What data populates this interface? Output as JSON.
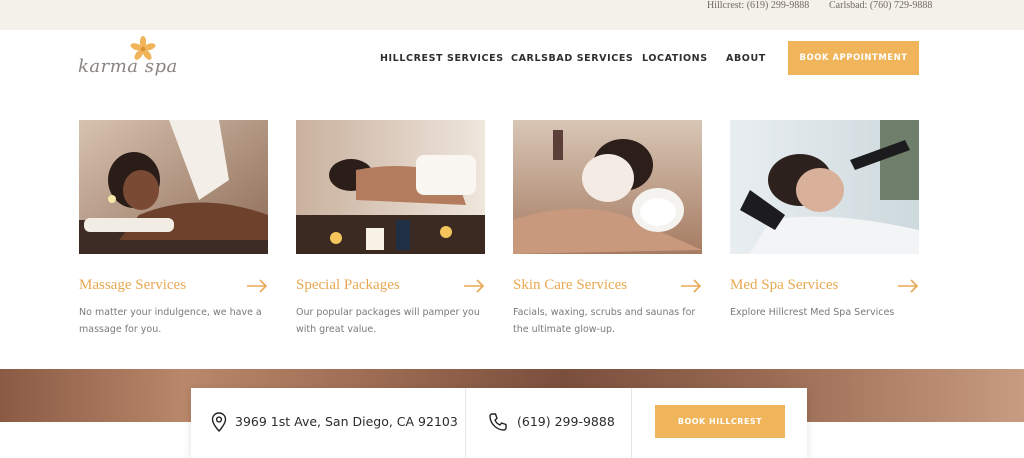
{
  "topbar": {
    "hillcrest_phone": "Hillcrest: (619) 299-9888",
    "carlsbad_phone": "Carlsbad: (760) 729-9888"
  },
  "logo": {
    "text": "karma spa",
    "icon": "flower-logo-icon"
  },
  "nav": {
    "items": [
      "HILLCREST SERVICES",
      "CARLSBAD SERVICES",
      "LOCATIONS",
      "ABOUT"
    ],
    "book_label": "BOOK APPOINTMENT"
  },
  "cards": [
    {
      "title": "Massage Services",
      "desc": "No matter your indulgence, we have a massage for you.",
      "image": "woman-receiving-back-massage"
    },
    {
      "title": "Special Packages",
      "desc": "Our popular packages will pamper you with great value.",
      "image": "woman-spa-facial-with-candles"
    },
    {
      "title": "Skin Care Services",
      "desc": "Facials, waxing, scrubs and saunas for the ultimate glow-up.",
      "image": "woman-with-facial-mask"
    },
    {
      "title": "Med Spa Services",
      "desc": "Explore Hillcrest Med Spa Services",
      "image": "woman-receiving-med-spa-treatment"
    }
  ],
  "infobar": {
    "address": "3969 1st Ave, San Diego, CA 92103",
    "phone": "(619) 299-9888",
    "book_label": "BOOK HILLCREST"
  },
  "colors": {
    "accent": "#f0b45a",
    "title": "#e8a852",
    "topbar_bg": "#f4f0ea"
  }
}
